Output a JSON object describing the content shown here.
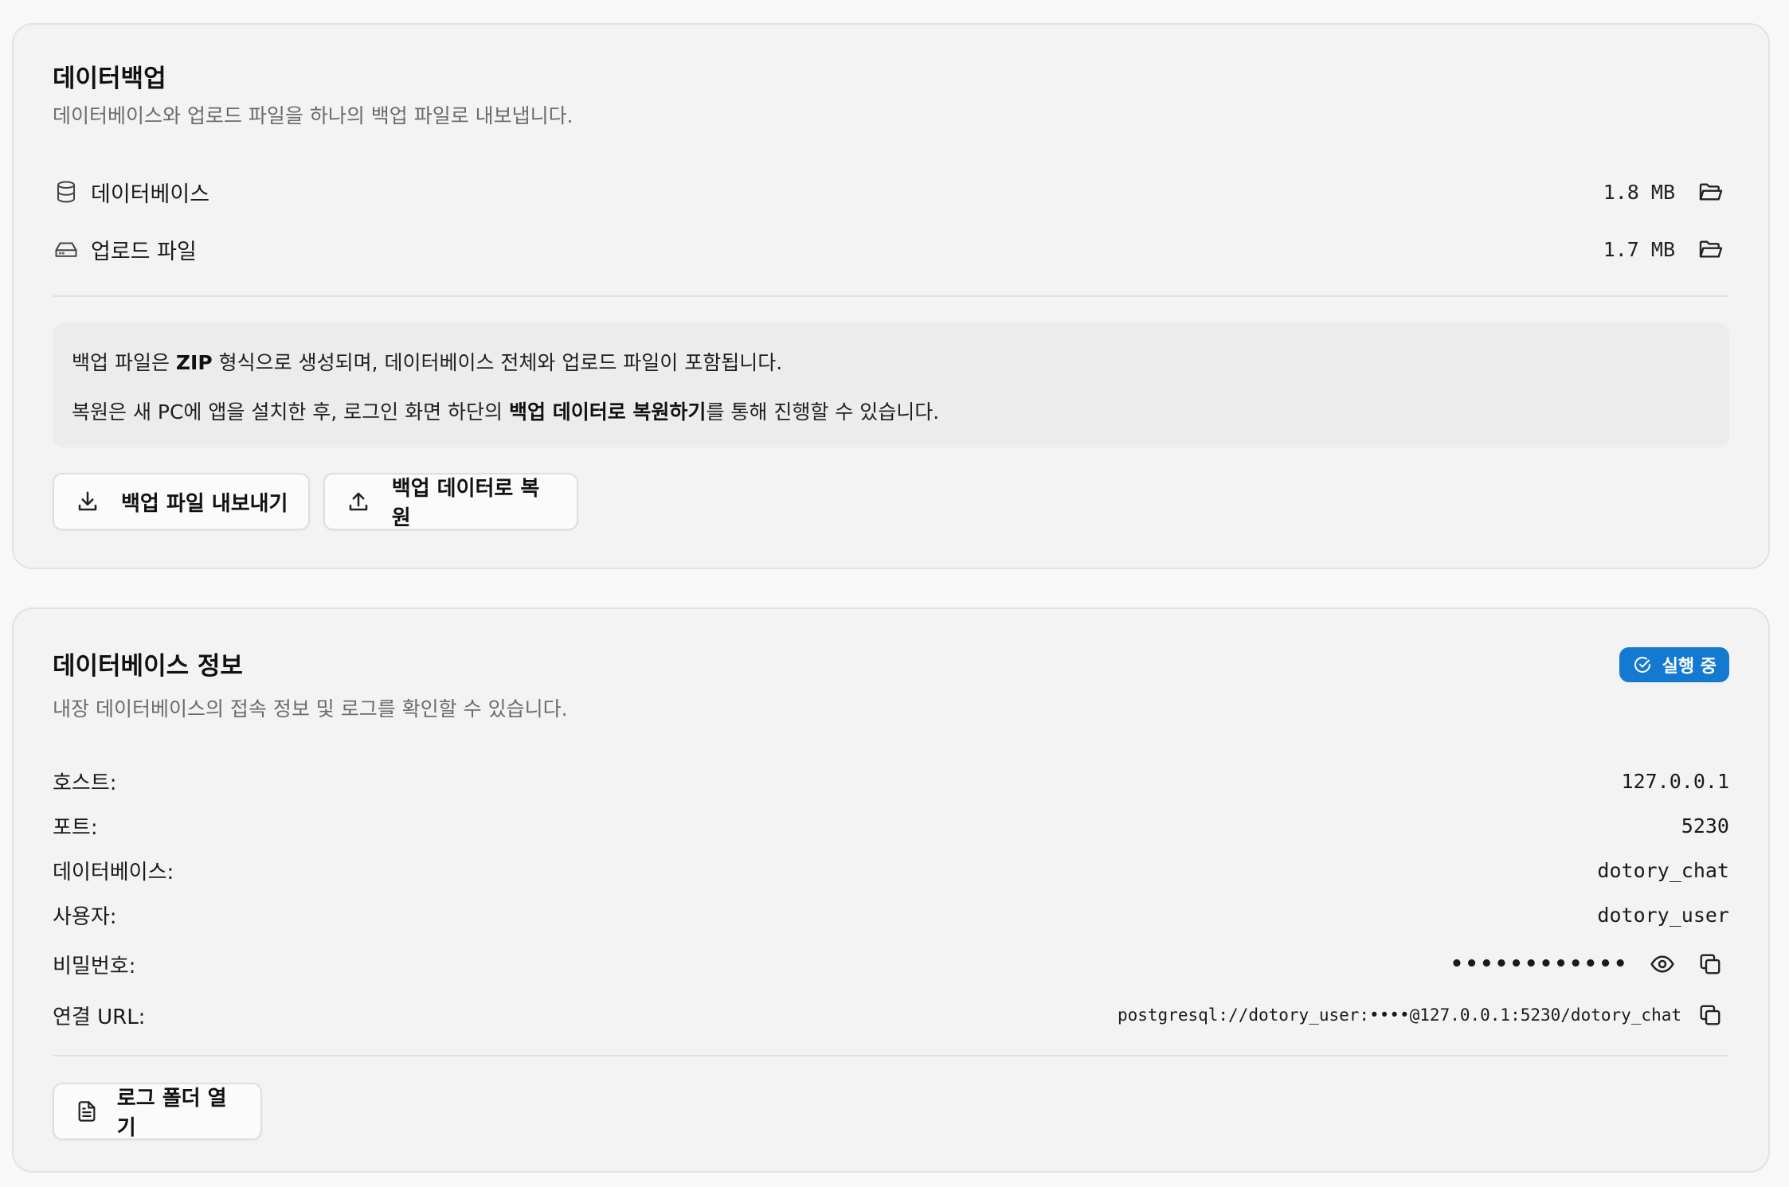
{
  "backup": {
    "title": "데이터백업",
    "description": "데이터베이스와 업로드 파일을 하나의 백업 파일로 내보냅니다.",
    "items": [
      {
        "label": "데이터베이스",
        "size": "1.8 MB",
        "icon": "database-icon"
      },
      {
        "label": "업로드 파일",
        "size": "1.7 MB",
        "icon": "hard-drive-icon"
      }
    ],
    "info": {
      "line1_a": "백업 파일은 ",
      "line1_b": "ZIP",
      "line1_c": " 형식으로 생성되며, 데이터베이스 전체와 업로드 파일이 포함됩니다.",
      "line2_a": "복원은 새 PC에 앱을 설치한 후, 로그인 화면 하단의 ",
      "line2_b": "백업 데이터로 복원하기",
      "line2_c": "를 통해 진행할 수 있습니다."
    },
    "export_label": "백업 파일 내보내기",
    "restore_label": "백업 데이터로 복원"
  },
  "database": {
    "title": "데이터베이스 정보",
    "description": "내장 데이터베이스의 접속 정보 및 로그를 확인할 수 있습니다.",
    "status": "실행 중",
    "status_color": "#1479d0",
    "rows": [
      {
        "key": "호스트:",
        "value": "127.0.0.1"
      },
      {
        "key": "포트:",
        "value": "5230"
      },
      {
        "key": "데이터베이스:",
        "value": "dotory_chat"
      },
      {
        "key": "사용자:",
        "value": "dotory_user"
      }
    ],
    "password_label": "비밀번호:",
    "password_masked": "••••••••••••",
    "url_label": "연결 URL:",
    "url_value": "postgresql://dotory_user:••••@127.0.0.1:5230/dotory_chat",
    "log_button": "로그 폴더 열기"
  }
}
